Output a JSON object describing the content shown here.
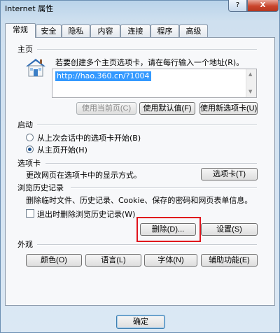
{
  "window": {
    "title": "Internet 属性",
    "help_label": "?",
    "close_label": "X"
  },
  "tabs": [
    "常规",
    "安全",
    "隐私",
    "内容",
    "连接",
    "程序",
    "高级"
  ],
  "homepage": {
    "section_label": "主页",
    "instruction": "若要创建多个主页选项卡，请在每行输入一个地址(R)。",
    "url": "http://hao.360.cn/?1004",
    "use_current_label": "使用当前页(C)",
    "use_default_label": "使用默认值(F)",
    "use_new_tab_label": "使用新选项卡(U)"
  },
  "startup": {
    "section_label": "启动",
    "option_last_session": "从上次会话中的选项卡开始(B)",
    "option_home_page": "从主页开始(H)",
    "selected": "option_home_page"
  },
  "tabs_section": {
    "section_label": "选项卡",
    "description": "更改网页在选项卡中的显示方式。",
    "tabs_button_label": "选项卡(T)"
  },
  "history": {
    "section_label": "浏览历史记录",
    "description": "删除临时文件、历史记录、Cookie、保存的密码和网页表单信息。",
    "delete_on_exit_label": "退出时删除浏览历史记录(W)",
    "delete_on_exit_checked": false,
    "delete_button_label": "删除(D)...",
    "settings_button_label": "设置(S)"
  },
  "appearance": {
    "section_label": "外观",
    "colors_label": "颜色(O)",
    "languages_label": "语言(L)",
    "fonts_label": "字体(N)",
    "accessibility_label": "辅助功能(E)"
  },
  "footer": {
    "ok_label": "确定"
  },
  "colors": {
    "highlight": "#e0131c",
    "selection": "#3399ff"
  }
}
